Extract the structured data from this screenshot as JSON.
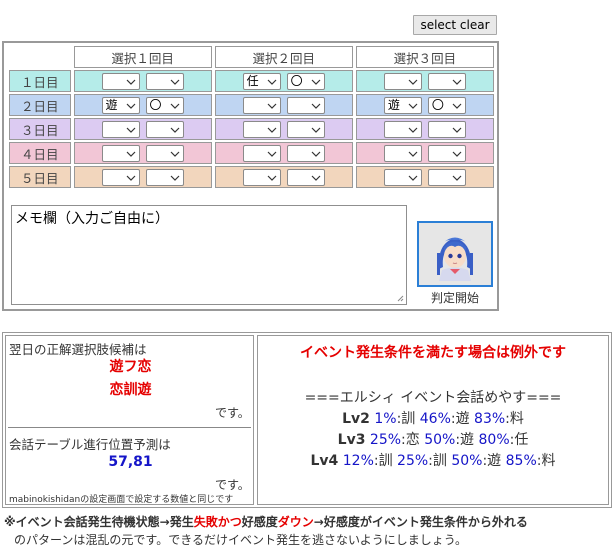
{
  "select_clear": "select clear",
  "columns": [
    "選択１回目",
    "選択２回目",
    "選択３回目"
  ],
  "rows": [
    {
      "label": "１日目",
      "color": "#b5ece9",
      "cells": [
        [
          "",
          ""
        ],
        [
          "任",
          "〇"
        ],
        [
          "",
          ""
        ]
      ]
    },
    {
      "label": "２日目",
      "color": "#bfd5f2",
      "cells": [
        [
          "遊",
          "〇"
        ],
        [
          "",
          ""
        ],
        [
          "遊",
          "〇"
        ]
      ]
    },
    {
      "label": "３日目",
      "color": "#dccbf2",
      "cells": [
        [
          "",
          ""
        ],
        [
          "",
          ""
        ],
        [
          "",
          ""
        ]
      ]
    },
    {
      "label": "４日目",
      "color": "#f2c6d6",
      "cells": [
        [
          "",
          ""
        ],
        [
          "",
          ""
        ],
        [
          "",
          ""
        ]
      ]
    },
    {
      "label": "５日目",
      "color": "#f2d6bd",
      "cells": [
        [
          "",
          ""
        ],
        [
          "",
          ""
        ],
        [
          "",
          ""
        ]
      ]
    }
  ],
  "memo": "メモ欄（入力ご自由に）",
  "judge_label": "判定開始",
  "left": {
    "candidates_title": "翌日の正解選択肢候補は",
    "candidates": [
      "遊フ恋",
      "恋訓遊"
    ],
    "desu": "です。",
    "position_title": "会話テーブル進行位置予測は",
    "position": "57,81",
    "footnote": "mabinokishidanの設定画面で設定する数値と同じです"
  },
  "right": {
    "headline": "イベント発生条件を満たす場合は例外です",
    "subtitle": "===エルシィ イベント会話めやす===",
    "levels": [
      {
        "lv": "Lv2",
        "parts": [
          [
            "1%",
            "b"
          ],
          [
            ":訓 ",
            ""
          ],
          [
            "46%",
            "b"
          ],
          [
            ":遊 ",
            ""
          ],
          [
            "83%",
            "b"
          ],
          [
            ":料",
            ""
          ]
        ]
      },
      {
        "lv": "Lv3",
        "parts": [
          [
            "25%",
            "b"
          ],
          [
            ":恋 ",
            ""
          ],
          [
            "50%",
            "b"
          ],
          [
            ":遊 ",
            ""
          ],
          [
            "80%",
            "b"
          ],
          [
            ":任",
            ""
          ]
        ]
      },
      {
        "lv": "Lv4",
        "parts": [
          [
            "12%",
            "b"
          ],
          [
            ":訓 ",
            ""
          ],
          [
            "25%",
            "b"
          ],
          [
            ":訓 ",
            ""
          ],
          [
            "50%",
            "b"
          ],
          [
            ":遊 ",
            ""
          ],
          [
            "85%",
            "b"
          ],
          [
            ":料",
            ""
          ]
        ]
      }
    ]
  },
  "note1": {
    "a": "※イベント会話発生待機状態→発生",
    "b": "失敗かつ",
    "c": "好感度",
    "d": "ダウン",
    "e": "→好感度がイベント発生条件から外れる"
  },
  "note2": "のパターンは混乱の元です。できるだけイベント発生を逃さないようにしましょう。"
}
